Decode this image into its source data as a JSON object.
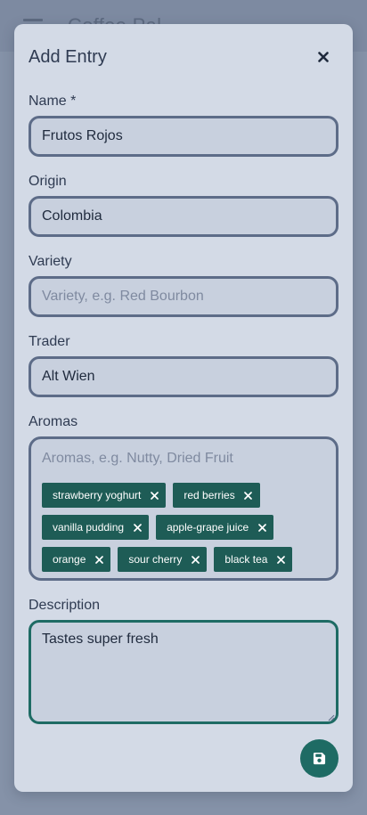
{
  "app": {
    "title": "Coffee Pal"
  },
  "modal": {
    "title": "Add Entry",
    "close_icon": "close-icon",
    "save_icon": "save-icon",
    "accent_color": "#1e6b64"
  },
  "form": {
    "name": {
      "label": "Name *",
      "value": "Frutos Rojos",
      "placeholder": ""
    },
    "origin": {
      "label": "Origin",
      "value": "Colombia",
      "placeholder": ""
    },
    "variety": {
      "label": "Variety",
      "value": "",
      "placeholder": "Variety, e.g. Red Bourbon"
    },
    "trader": {
      "label": "Trader",
      "value": "Alt Wien",
      "placeholder": ""
    },
    "aromas": {
      "label": "Aromas",
      "placeholder": "Aromas, e.g. Nutty, Dried Fruit",
      "tags": [
        "strawberry yoghurt",
        "red berries",
        "vanilla pudding",
        "apple-grape juice",
        "orange",
        "sour cherry",
        "black tea"
      ]
    },
    "description": {
      "label": "Description",
      "value": "Tastes super fresh"
    }
  }
}
